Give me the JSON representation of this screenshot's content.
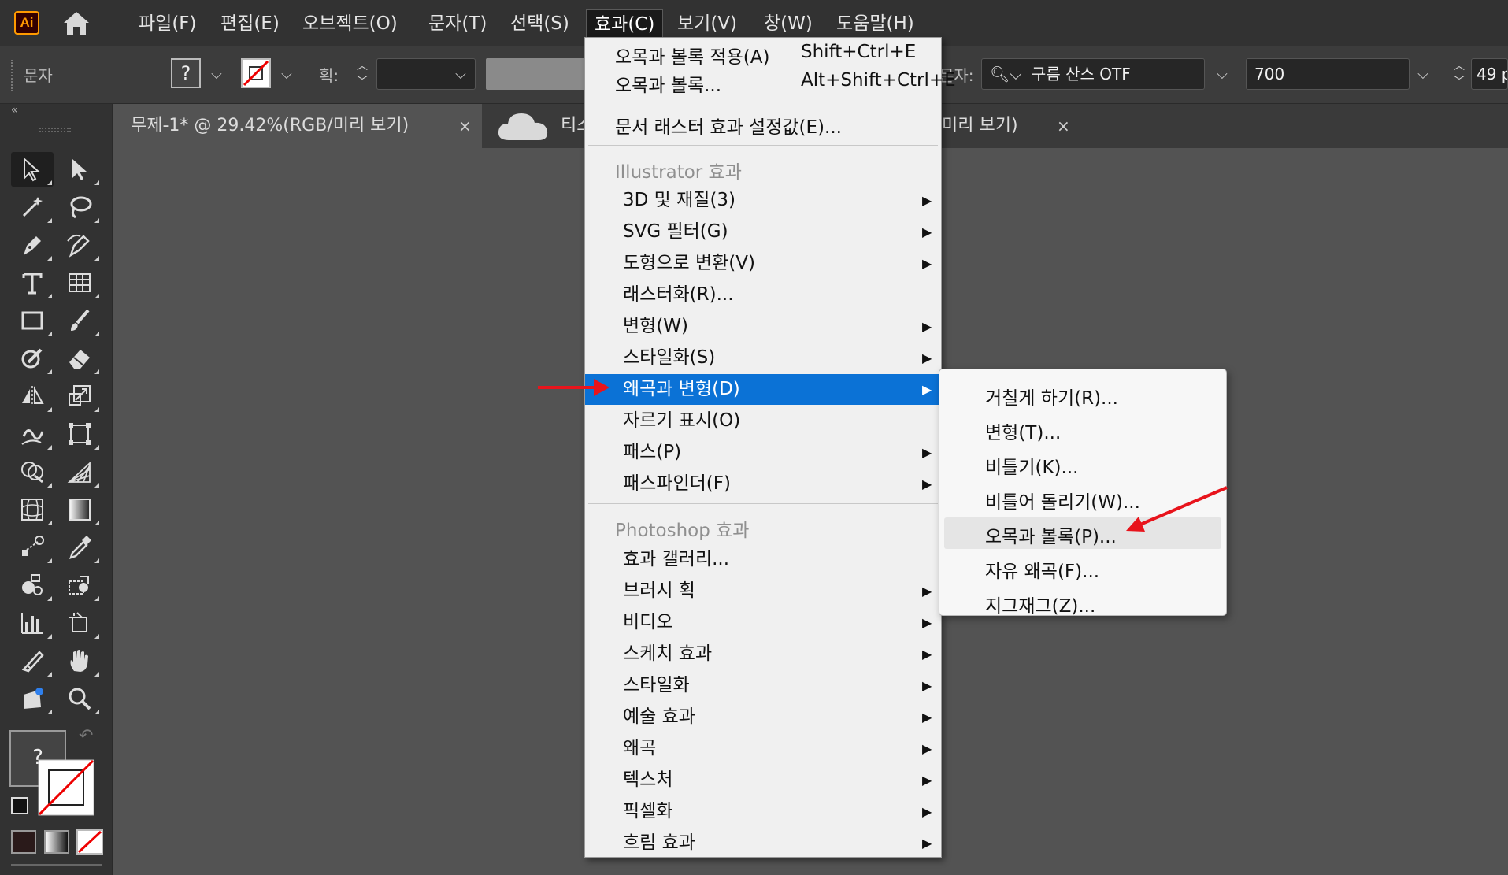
{
  "app": {
    "logo_text": "Ai",
    "menus": [
      "파일(F)",
      "편집(E)",
      "오브젝트(O)",
      "문자(T)",
      "선택(S)",
      "효과(C)",
      "보기(V)",
      "창(W)",
      "도움말(H)"
    ],
    "active_menu": "효과(C)"
  },
  "control_bar": {
    "mode_label": "문자",
    "fill_swatch_glyph": "?",
    "stroke_label": "획:",
    "char_label": "문자:",
    "font_name": "구름 산스 OTF",
    "font_weight": "700",
    "font_size": "49 p"
  },
  "tabs": [
    {
      "label": "무제-1* @ 29.42%(RGB/미리 보기)",
      "close": "×",
      "active": true
    },
    {
      "label": "티스",
      "close": "",
      "active": false
    },
    {
      "label": "미리 보기)",
      "close": "×",
      "active": false
    }
  ],
  "toolbar": {
    "collapse_glyph": "«",
    "fill_glyph": "?",
    "tools": [
      "selection",
      "direct-selection",
      "magic-wand",
      "lasso",
      "pen",
      "curvature",
      "type",
      "grid",
      "rectangle",
      "paintbrush",
      "shaper",
      "eraser",
      "reflect",
      "scale",
      "warp",
      "free-transform",
      "shape-builder",
      "perspective-grid",
      "mesh",
      "gradient",
      "blend",
      "eyedropper",
      "symbol-sprayer",
      "live-paint",
      "column-graph",
      "artboard",
      "slice",
      "hand",
      "puppet-warp",
      "zoom"
    ]
  },
  "effect_menu": {
    "apply_last": {
      "label": "오목과 볼록 적용(A)",
      "shortcut": "Shift+Ctrl+E"
    },
    "last_effect": {
      "label": "오목과 볼록...",
      "shortcut": "Alt+Shift+Ctrl+E"
    },
    "raster_settings": "문서 래스터 효과 설정값(E)...",
    "illustrator_header": "Illustrator 효과",
    "illustrator_items": [
      {
        "label": "3D 및 재질(3)",
        "submenu": true
      },
      {
        "label": "SVG 필터(G)",
        "submenu": true
      },
      {
        "label": "도형으로 변환(V)",
        "submenu": true
      },
      {
        "label": "래스터화(R)...",
        "submenu": false
      },
      {
        "label": "변형(W)",
        "submenu": true
      },
      {
        "label": "스타일화(S)",
        "submenu": true
      },
      {
        "label": "왜곡과 변형(D)",
        "submenu": true,
        "highlighted": true
      },
      {
        "label": "자르기 표시(O)",
        "submenu": false
      },
      {
        "label": "패스(P)",
        "submenu": true
      },
      {
        "label": "패스파인더(F)",
        "submenu": true
      }
    ],
    "photoshop_header": "Photoshop 효과",
    "photoshop_items": [
      {
        "label": "효과 갤러리...",
        "submenu": false
      },
      {
        "label": "브러시 획",
        "submenu": true
      },
      {
        "label": "비디오",
        "submenu": true
      },
      {
        "label": "스케치 효과",
        "submenu": true
      },
      {
        "label": "스타일화",
        "submenu": true
      },
      {
        "label": "예술 효과",
        "submenu": true
      },
      {
        "label": "왜곡",
        "submenu": true
      },
      {
        "label": "텍스처",
        "submenu": true
      },
      {
        "label": "픽셀화",
        "submenu": true
      },
      {
        "label": "흐림 효과",
        "submenu": true
      }
    ]
  },
  "distort_submenu": [
    {
      "label": "거칠게 하기(R)...",
      "hover": false
    },
    {
      "label": "변형(T)...",
      "hover": false
    },
    {
      "label": "비틀기(K)...",
      "hover": false
    },
    {
      "label": "비틀어 돌리기(W)...",
      "hover": false
    },
    {
      "label": "오목과 볼록(P)...",
      "hover": true
    },
    {
      "label": "자유 왜곡(F)...",
      "hover": false
    },
    {
      "label": "지그재그(Z)...",
      "hover": false
    }
  ],
  "colors": {
    "highlight": "#0b72d6",
    "annotation_arrow": "#e8141c",
    "app_orange": "#ff9a00"
  }
}
